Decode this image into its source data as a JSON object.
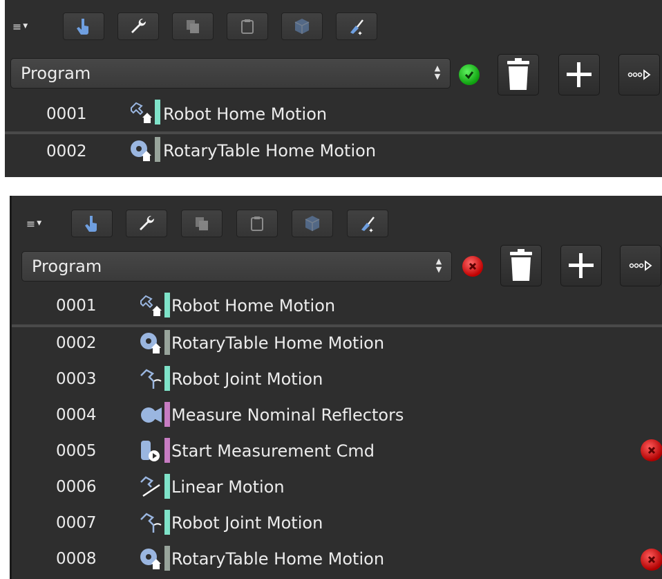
{
  "colors": {
    "panel_bg": "#2e2e2e",
    "toolbar_icon_blue": "#6f9fe0",
    "bar_teal": "#7fe3c9",
    "bar_gray": "#98a49b",
    "bar_pink": "#c77cc2",
    "status_ok": "#1ec81e",
    "status_error": "#d01818"
  },
  "panels": [
    {
      "program_select": {
        "value": "Program",
        "status": "ok"
      },
      "toolbar_icons": [
        "list-menu-icon",
        "hand-pointer-icon",
        "wrench-icon",
        "copy-icon",
        "clipboard-icon",
        "cube-icon",
        "clear-broom-icon"
      ],
      "actions": [
        "trash-icon",
        "plus-icon",
        "run-arrow-icon"
      ],
      "rows": [
        {
          "num": "0001",
          "label": "Robot Home Motion",
          "icon": "robot-home-icon",
          "bar": "teal"
        },
        {
          "num": "0002",
          "label": "RotaryTable Home Motion",
          "icon": "rotary-home-icon",
          "bar": "gray"
        }
      ]
    },
    {
      "program_select": {
        "value": "Program",
        "status": "error"
      },
      "toolbar_icons": [
        "list-menu-icon",
        "hand-pointer-icon",
        "wrench-icon",
        "copy-icon",
        "clipboard-icon",
        "cube-icon",
        "clear-broom-icon"
      ],
      "actions": [
        "trash-icon",
        "plus-icon",
        "run-arrow-icon"
      ],
      "rows": [
        {
          "num": "0001",
          "label": "Robot Home Motion",
          "icon": "robot-home-icon",
          "bar": "teal",
          "error": false
        },
        {
          "num": "0002",
          "label": "RotaryTable Home Motion",
          "icon": "rotary-home-icon",
          "bar": "gray",
          "error": false
        },
        {
          "num": "0003",
          "label": "Robot Joint Motion",
          "icon": "robot-joint-icon",
          "bar": "teal",
          "error": false
        },
        {
          "num": "0004",
          "label": "Measure Nominal Reflectors",
          "icon": "camera-icon",
          "bar": "pink",
          "error": false
        },
        {
          "num": "0005",
          "label": "Start Measurement Cmd",
          "icon": "measure-start-icon",
          "bar": "pink",
          "error": true
        },
        {
          "num": "0006",
          "label": "Linear Motion",
          "icon": "linear-motion-icon",
          "bar": "teal",
          "error": false
        },
        {
          "num": "0007",
          "label": "Robot Joint Motion",
          "icon": "robot-joint-icon",
          "bar": "teal",
          "error": false
        },
        {
          "num": "0008",
          "label": "RotaryTable Home Motion",
          "icon": "rotary-home-icon",
          "bar": "gray",
          "error": true
        }
      ]
    }
  ]
}
